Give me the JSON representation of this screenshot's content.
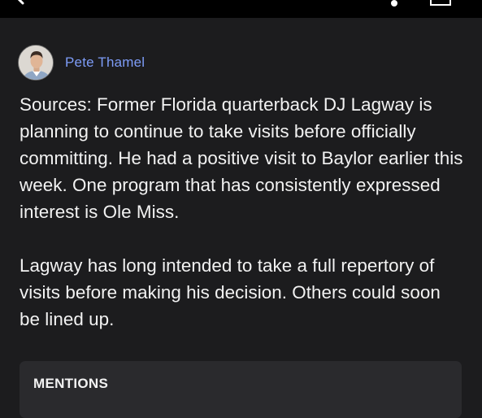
{
  "author": {
    "name": "Pete Thamel"
  },
  "post": {
    "paragraphs": [
      "Sources: Former Florida quarterback DJ Lagway is planning to continue to take visits before officially committing. He had a positive visit to Baylor earlier this week. One program that has consistently expressed interest is Ole Miss.",
      "Lagway has long intended to take a full repertory of visits before making his decision. Others could soon be lined up."
    ]
  },
  "mentions": {
    "title": "MENTIONS"
  },
  "colors": {
    "background": "#1c1c1e",
    "topbar": "#000000",
    "author_link": "#7d9cf7",
    "card": "#2a2a2d",
    "text": "#f2f2f2"
  },
  "icons": {
    "back": "chevron-left-icon",
    "more": "more-icon",
    "share": "share-icon"
  }
}
